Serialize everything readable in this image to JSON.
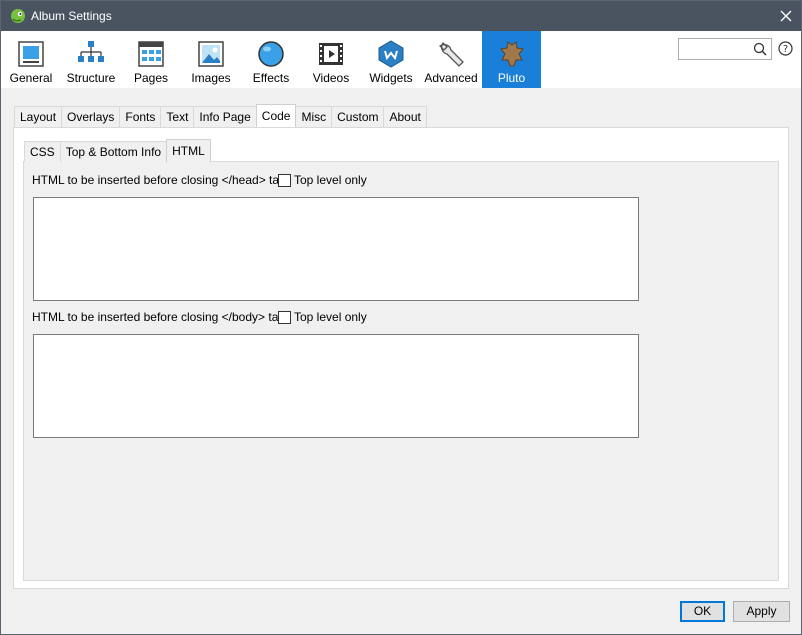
{
  "window": {
    "title": "Album Settings"
  },
  "toolbar": {
    "items": [
      {
        "label": "General"
      },
      {
        "label": "Structure"
      },
      {
        "label": "Pages"
      },
      {
        "label": "Images"
      },
      {
        "label": "Effects"
      },
      {
        "label": "Videos"
      },
      {
        "label": "Widgets"
      },
      {
        "label": "Advanced"
      },
      {
        "label": "Pluto"
      }
    ],
    "active": "Pluto"
  },
  "search": {
    "value": ""
  },
  "tabs": {
    "items": [
      "Layout",
      "Overlays",
      "Fonts",
      "Text",
      "Info Page",
      "Code",
      "Misc",
      "Custom",
      "About"
    ],
    "selected": "Code"
  },
  "subtabs": {
    "items": [
      "CSS",
      "Top & Bottom Info",
      "HTML"
    ],
    "selected": "HTML"
  },
  "html_panel": {
    "head_label": "HTML to be inserted before closing </head> tag",
    "head_toplevel_label": "Top level only",
    "head_toplevel_checked": false,
    "head_value": "",
    "body_label": "HTML to be inserted before closing </body> tag",
    "body_toplevel_label": "Top level only",
    "body_toplevel_checked": false,
    "body_value": ""
  },
  "buttons": {
    "ok": "OK",
    "apply": "Apply"
  },
  "colors": {
    "titlebar": "#4a5461",
    "accent": "#1a7fd8"
  }
}
